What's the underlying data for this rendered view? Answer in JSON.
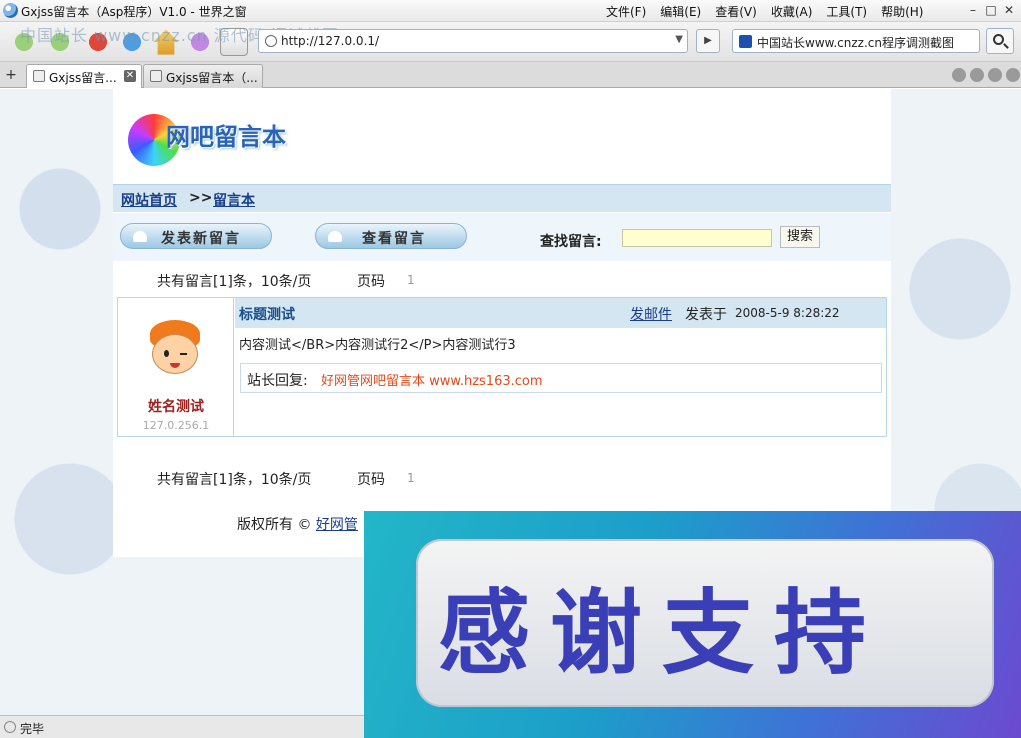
{
  "window": {
    "title": "Gxjss留言本（Asp程序）V1.0 - 世界之窗",
    "menu": [
      "文件(F)",
      "编辑(E)",
      "查看(V)",
      "收藏(A)",
      "工具(T)",
      "帮助(H)"
    ],
    "controls": [
      "–",
      "□",
      "✕"
    ]
  },
  "toolbar": {
    "watermark": "中国站长 www.cnzz.cn 源代码 调试截图",
    "address": "http://127.0.0.1/",
    "search_text": "中国站长www.cnzz.cn程序调测截图"
  },
  "tabs": [
    {
      "label": "Gxjss留言..."
    },
    {
      "label": "Gxjss留言本（..."
    }
  ],
  "page": {
    "logo_text": "网吧留言本",
    "breadcrumb": {
      "home": "网站首页",
      "sep": ">>",
      "current": "留言本"
    },
    "actions": {
      "new": "发表新留言",
      "view": "查看留言"
    },
    "find": {
      "label": "查找留言:",
      "button": "搜索"
    },
    "pager": {
      "summary": "共有留言[1]条，10条/页",
      "page_label": "页码",
      "page_num": "1"
    },
    "message": {
      "author": "姓名测试",
      "ip": "127.0.256.1",
      "title": "标题测试",
      "mail_link": "发邮件",
      "posted_label": "发表于",
      "date": "2008-5-9 8:28:22",
      "content": "内容测试</BR>内容测试行2</P>内容测试行3",
      "reply_label": "站长回复:",
      "reply_text": "好网管网吧留言本 www.hzs163.com"
    },
    "footer": {
      "prefix": "版权所有 © ",
      "link": "好网管"
    }
  },
  "banner": {
    "text": "感谢支持"
  },
  "status": {
    "text": "完毕"
  }
}
